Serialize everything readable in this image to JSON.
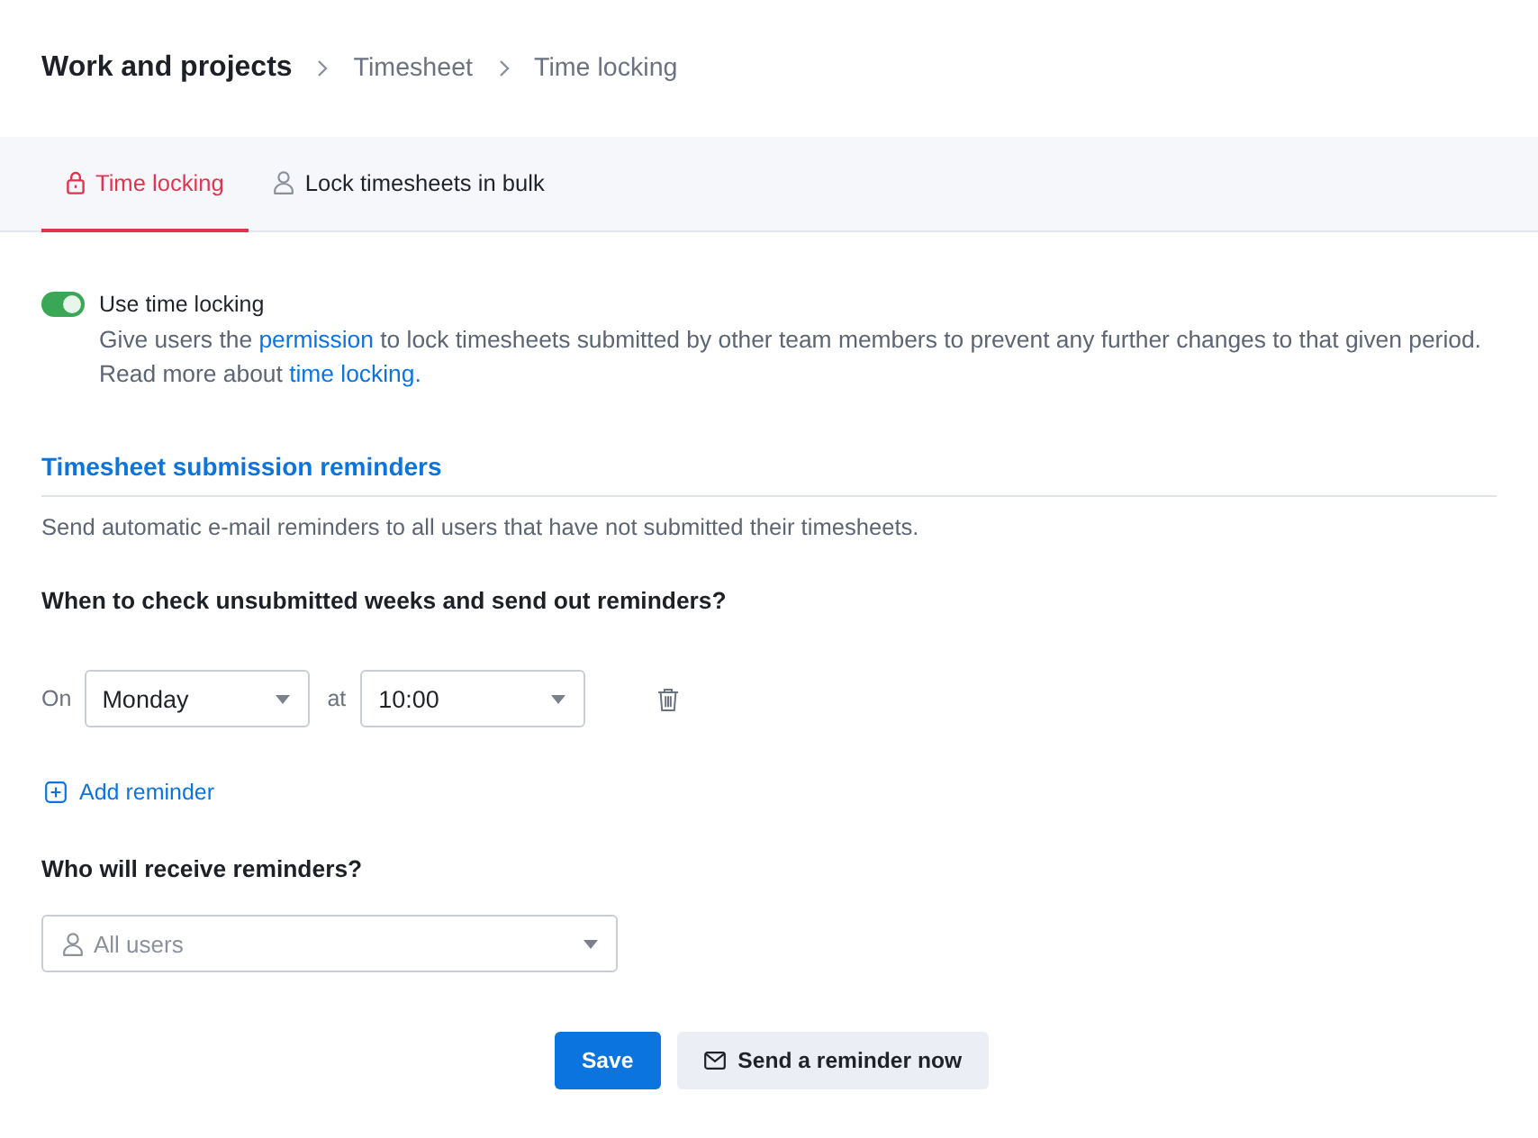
{
  "breadcrumb": [
    {
      "label": "Work and projects"
    },
    {
      "label": "Timesheet"
    },
    {
      "label": "Time locking"
    }
  ],
  "tabs": [
    {
      "label": "Time locking",
      "selected": true
    },
    {
      "label": "Lock timesheets in bulk",
      "selected": false
    }
  ],
  "time_locking": {
    "label": "Use time locking",
    "on": true,
    "description": [
      [
        {
          "kind": "text",
          "text": "Give users the "
        },
        {
          "kind": "link",
          "text": "permission"
        },
        {
          "kind": "text",
          "text": " to lock timesheets submitted by other team members to prevent any further changes to that given period."
        }
      ],
      [
        {
          "kind": "text",
          "text": "Read more about "
        },
        {
          "kind": "link",
          "text": "time locking."
        }
      ]
    ]
  },
  "reminders": {
    "title": "Timesheet submission reminders",
    "subtitle": "Send automatic e-mail reminders to all users that have not submitted their timesheets.",
    "question": "When to check unsubmitted weeks and send out reminders?",
    "items": [
      {
        "on_label": "On",
        "day": "Monday",
        "at_label": "at",
        "time": "10:00"
      }
    ],
    "add_label": "Add reminder"
  },
  "recipients": {
    "question": "Who will receive reminders?",
    "placeholder": "All users"
  },
  "buttons": [
    {
      "label": "Save",
      "kind": "primary"
    },
    {
      "label": "Send a reminder now",
      "kind": "secondary"
    }
  ]
}
